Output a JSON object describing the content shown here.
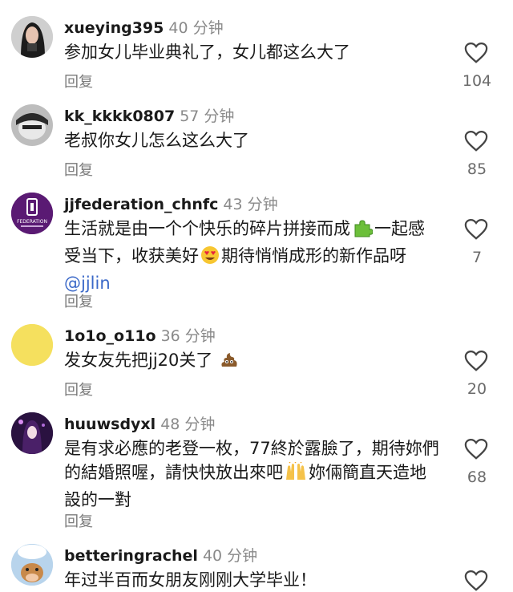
{
  "comments": [
    {
      "username": "xueying395",
      "time": "40 分钟",
      "text": "参加女儿毕业典礼了，女儿都这么大了",
      "reply": "回复",
      "likes": "104",
      "avatar": "photo-dark-hair"
    },
    {
      "username": "kk_kkkk0807",
      "time": "57 分钟",
      "text": "老叔你女儿怎么这么大了",
      "reply": "回复",
      "likes": "85",
      "avatar": "photo-grayscale"
    },
    {
      "username": "jjfederation_chnfc",
      "time": "43 分钟",
      "text_a": "生活就是由一个个快乐的碎片拼接而成",
      "text_b": "一起感受当下，收获美好",
      "text_c": "期待悄悄成形的新作品呀 ",
      "mention": "@jjlin",
      "reply": "回复",
      "likes": "7",
      "avatar": "federation-logo",
      "logo_text": "FEDERATION",
      "emoji_1": "puzzle-piece-emoji",
      "emoji_2": "heart-eyes-emoji"
    },
    {
      "username": "1o1o_o11o",
      "time": "36 分钟",
      "text": "发女友先把jj20关了",
      "reply": "回复",
      "likes": "20",
      "avatar": "yellow-circle",
      "emoji_1": "poop-emoji"
    },
    {
      "username": "huuwsdyxl",
      "time": "48 分钟",
      "text_a": "是有求必應的老登一枚，77終於露臉了，期待妳們的結婚照喔，請快快放出來吧",
      "text_b": "妳倆簡直天造地設的一對",
      "reply": "回复",
      "likes": "68",
      "avatar": "photo-purple-anime",
      "emoji_1": "raising-hands-emoji"
    },
    {
      "username": "betteringrachel",
      "time": "40 分钟",
      "text": "年过半百而女朋友刚刚大学毕业！",
      "avatar": "photo-cartoon-cow"
    }
  ],
  "colors": {
    "username": "#1a1a1a",
    "time": "#8a8a8a",
    "reply": "#7a7a7a",
    "mention": "#3a68c8",
    "heart_outline": "#444444"
  }
}
